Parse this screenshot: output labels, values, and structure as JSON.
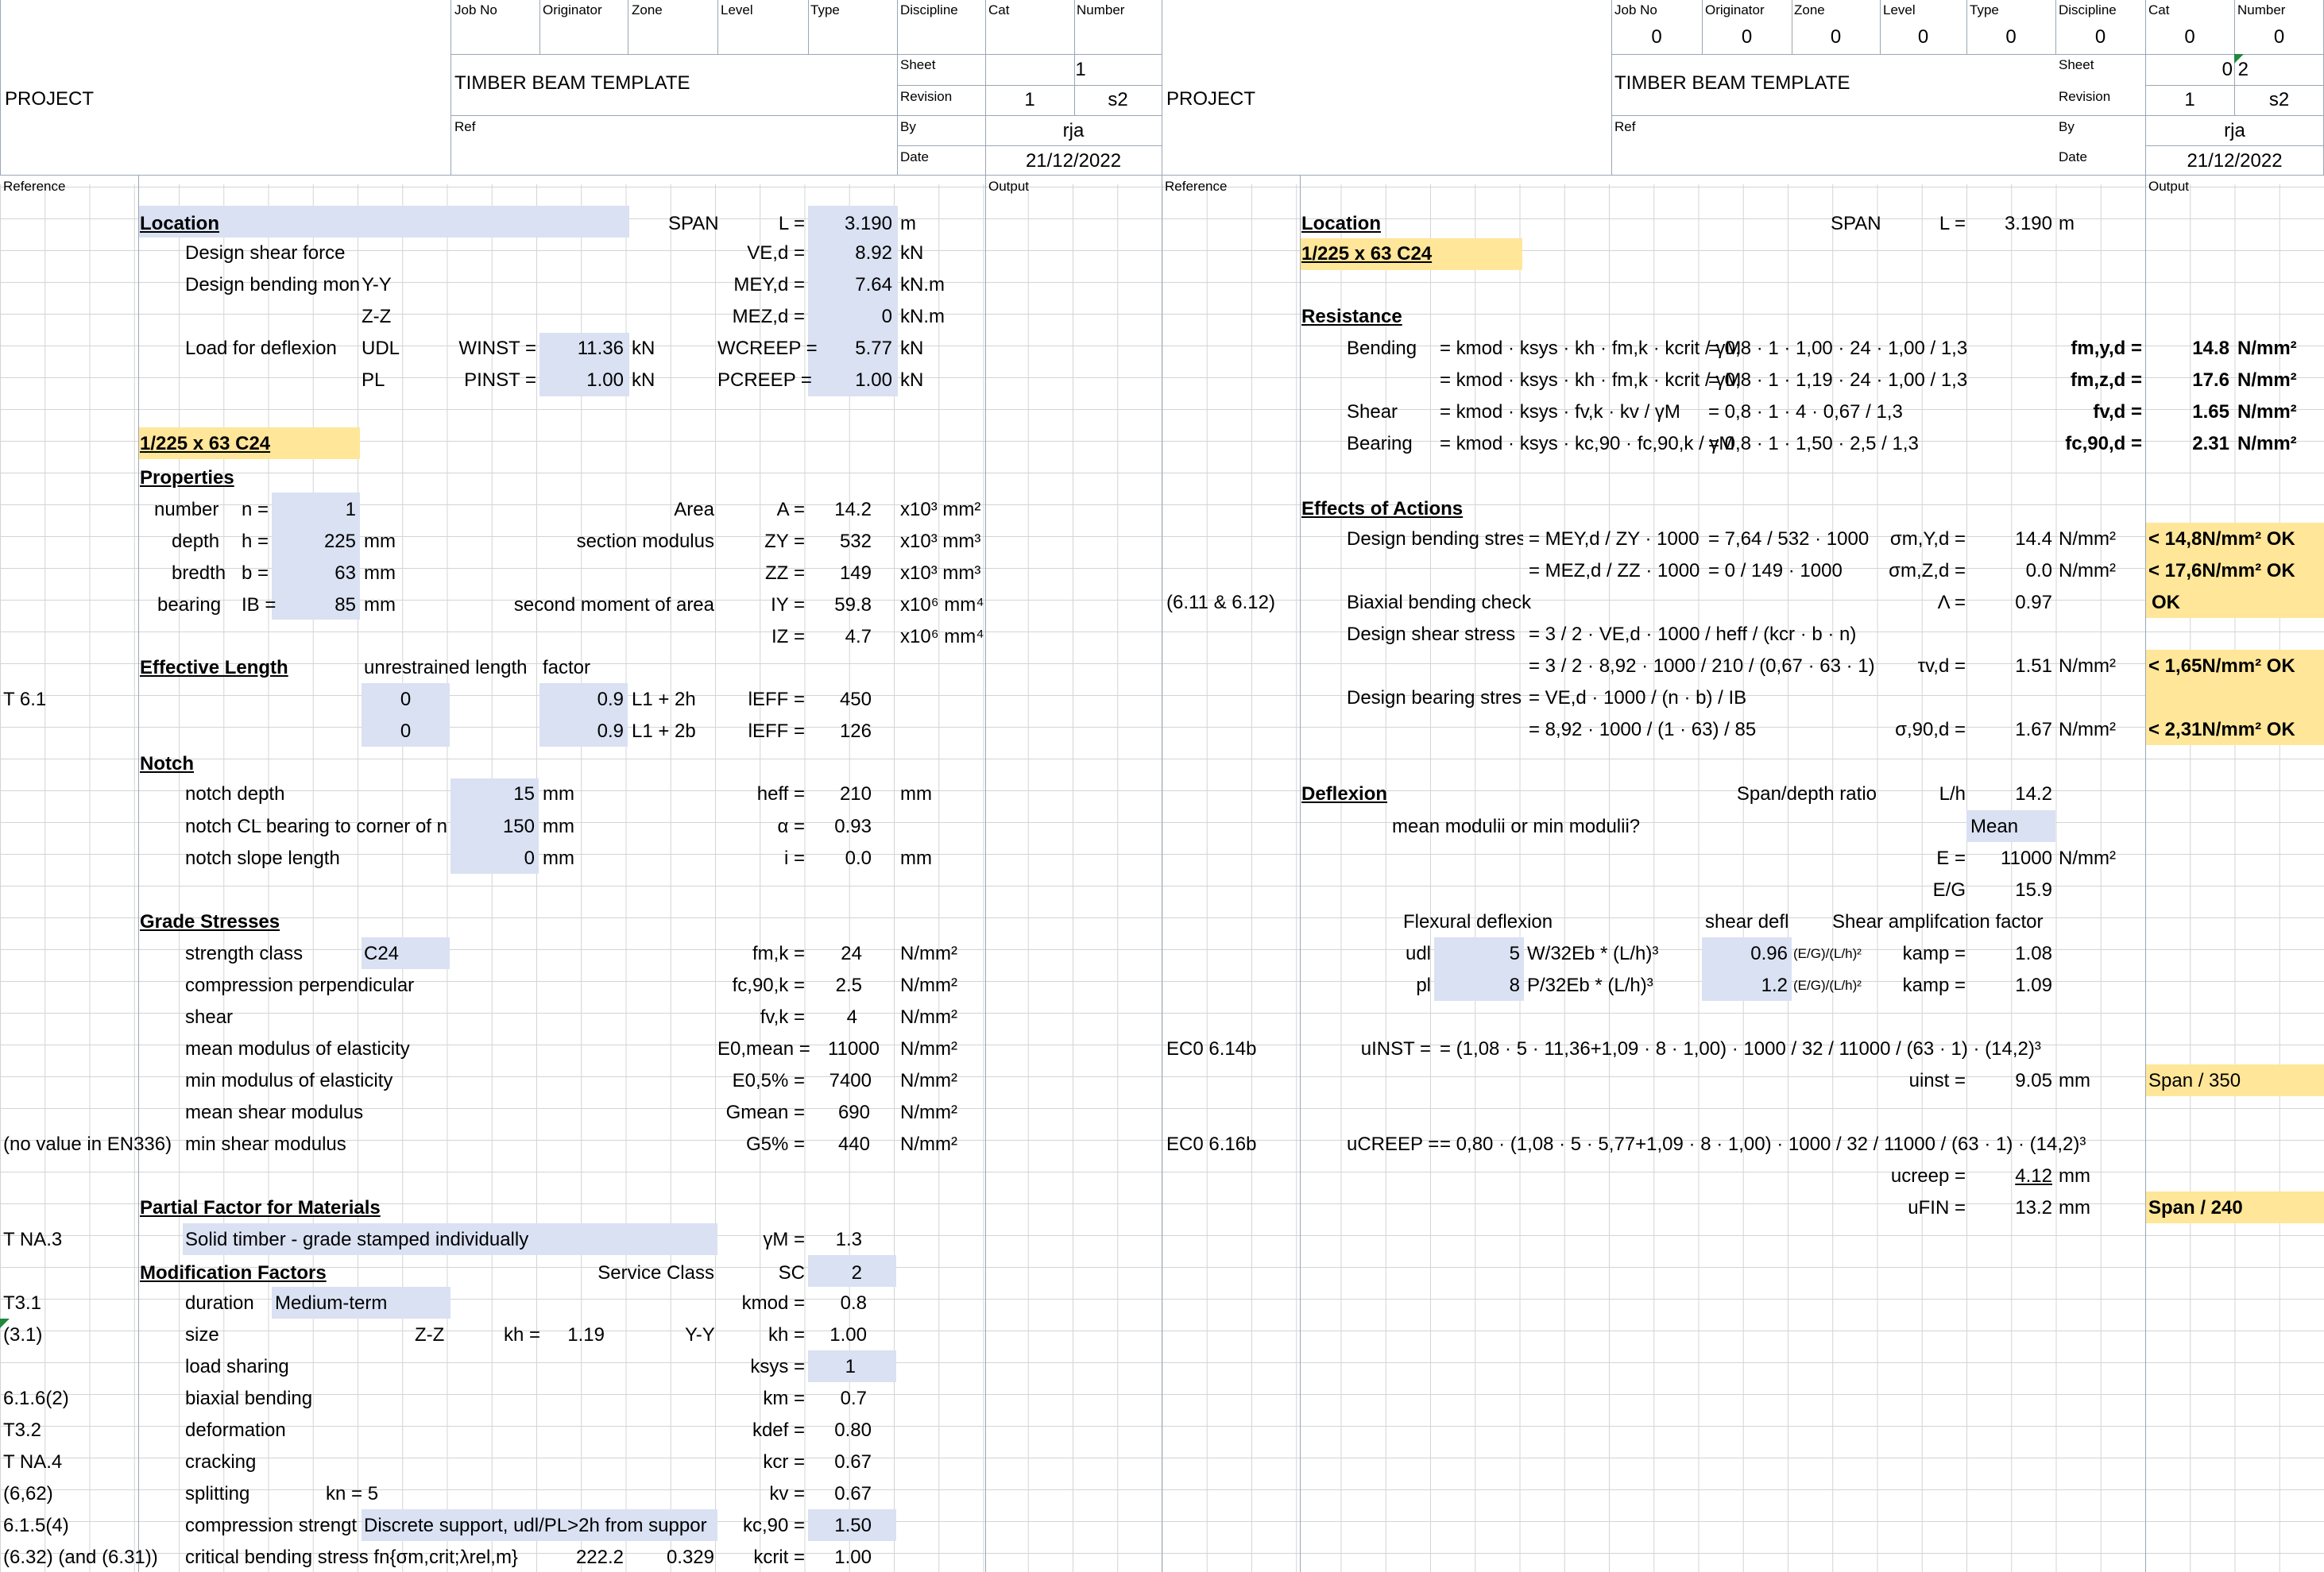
{
  "header_labels": [
    "Job No",
    "Originator",
    "Zone",
    "Level",
    "Type",
    "Discipline",
    "Cat",
    "Number",
    "Sheet",
    "Revision",
    "By",
    "Date",
    "Ref"
  ],
  "left_header": {
    "project": "PROJECT",
    "title": "TIMBER BEAM TEMPLATE",
    "sheet": "1",
    "revision": "1",
    "revision_code": "s2",
    "by": "rja",
    "date": "21/12/2022"
  },
  "right_header": {
    "project": "PROJECT",
    "title": "TIMBER BEAM TEMPLATE",
    "job_values": [
      "0",
      "0",
      "0",
      "0",
      "0",
      "0",
      "0",
      "0"
    ],
    "sheet": "0 2",
    "revision": "1",
    "revision_code": "s2",
    "by": "rja",
    "date": "21/12/2022"
  },
  "col_headers": {
    "reference": "Reference",
    "output": "Output"
  },
  "left": {
    "location": "Location",
    "span_label": "SPAN",
    "L_lbl": "L =",
    "L_val": "3.190",
    "L_unit": "m",
    "shear_force": "Design shear force",
    "VEd_lbl": "VE,d =",
    "VEd_val": "8.92",
    "VEd_unit": "kN",
    "bending_moment": "Design bending mon",
    "yy": "Y-Y",
    "MEy_lbl": "MEY,d =",
    "MEy_val": "7.64",
    "MEy_unit": "kN.m",
    "zz": "Z-Z",
    "MEz_lbl": "MEZ,d =",
    "MEz_val": "0",
    "MEz_unit": "kN.m",
    "load_defl": "Load for deflexion",
    "udl": "UDL",
    "winst_lbl": "WINST =",
    "winst_val": "11.36",
    "winst_unit": "kN",
    "wcreep_lbl": "WCREEP =",
    "wcreep_val": "5.77",
    "wcreep_unit": "kN",
    "pl": "PL",
    "pinst_lbl": "PINST =",
    "pinst_val": "1.00",
    "pinst_unit": "kN",
    "pcreep_lbl": "PCREEP =",
    "pcreep_val": "1.00",
    "pcreep_unit": "kN",
    "section": "1/225 x 63 C24",
    "properties": "Properties",
    "number": "number",
    "n_lbl": "n =",
    "n_val": "1",
    "area": "Area",
    "A_lbl": "A =",
    "A_val": "14.2",
    "A_unit": "x10³ mm²",
    "depth": "depth",
    "h_lbl": "h =",
    "h_val": "225",
    "h_unit": "mm",
    "sect_mod": "section modulus",
    "Zy_lbl": "ZY =",
    "Zy_val": "532",
    "Zy_unit": "x10³ mm³",
    "bredth": "bredth",
    "b_lbl": "b =",
    "b_val": "63",
    "b_unit": "mm",
    "Zz_lbl": "ZZ =",
    "Zz_val": "149",
    "Zz_unit": "x10³ mm³",
    "bearing": "bearing",
    "IB_lbl": "IB =",
    "IB_val": "85",
    "IB_unit": "mm",
    "second_moment": "second moment of area",
    "Iy_lbl": "IY =",
    "Iy_val": "59.8",
    "Iy_unit": "x10⁶ mm⁴",
    "Iz_lbl": "IZ =",
    "Iz_val": "4.7",
    "Iz_unit": "x10⁶ mm⁴",
    "eff_len": "Effective Length",
    "unrestrained": "unrestrained length",
    "factor": "factor",
    "t61": "T 6.1",
    "ul1": "0",
    "f1": "0.9",
    "lf1": "L1 + 2h",
    "ieff1_lbl": "lEFF =",
    "ieff1_val": "450",
    "ul2": "0",
    "f2": "0.9",
    "lf2": "L1 + 2b",
    "ieff2_lbl": "lEFF =",
    "ieff2_val": "126",
    "notch": "Notch",
    "notch_depth": "notch depth",
    "nd_val": "15",
    "nd_unit": "mm",
    "heff_lbl": "heff =",
    "heff_val": "210",
    "heff_unit": "mm",
    "notch_cl": "notch CL bearing to corner of n",
    "ncl_val": "150",
    "ncl_unit": "mm",
    "alpha_lbl": "α =",
    "alpha_val": "0.93",
    "notch_slope": "notch slope length",
    "ns_val": "0",
    "ns_unit": "mm",
    "i_lbl": "i =",
    "i_val": "0.0",
    "i_unit": "mm",
    "grade": "Grade Stresses",
    "strength_class": "strength class",
    "sc_val": "C24",
    "fmk_lbl": "fm,k =",
    "fmk_val": "24",
    "fmk_unit": "N/mm²",
    "comp_perp": "compression perpendicular",
    "fc90_lbl": "fc,90,k =",
    "fc90_val": "2.5",
    "fc90_unit": "N/mm²",
    "shear": "shear",
    "fvk_lbl": "fv,k =",
    "fvk_val": "4",
    "fvk_unit": "N/mm²",
    "mean_moe": "mean modulus of elasticity",
    "E0_lbl": "E0,mean =",
    "E0_val": "11000",
    "E0_unit": "N/mm²",
    "min_moe": "min modulus of elasticity",
    "E05_lbl": "E0,5% =",
    "E05_val": "7400",
    "E05_unit": "N/mm²",
    "mean_shear": "mean shear modulus",
    "Gm_lbl": "Gmean =",
    "Gm_val": "690",
    "Gm_unit": "N/mm²",
    "no_value": "(no value in EN336)",
    "min_shear": "min shear modulus",
    "G5_lbl": "G5% =",
    "G5_val": "440",
    "G5_unit": "N/mm²",
    "partial": "Partial Factor for Materials",
    "tna3": "T NA.3",
    "solid": "Solid timber - grade stamped individually",
    "gm_lbl": "γM =",
    "gm_val": "1.3",
    "modf": "Modification Factors",
    "service_class": "Service Class",
    "SC_lbl": "SC",
    "SC_val": "2",
    "t31": "T3.1",
    "duration": "duration",
    "dur_val": "Medium-term",
    "kmod_lbl": "kmod =",
    "kmod_val": "0.8",
    "r31": "(3.1)",
    "size": "size",
    "zz2": "Z-Z",
    "kh_lbl": "kh =",
    "kh_z": "1.19",
    "yy2": "Y-Y",
    "kh2_lbl": "kh =",
    "kh_y": "1.00",
    "load_sharing": "load sharing",
    "ksys_lbl": "ksys =",
    "ksys_val": "1",
    "r616": "6.1.6(2)",
    "biaxial": "biaxial bending",
    "km_lbl": "km =",
    "km_val": "0.7",
    "t32": "T3.2",
    "deformation": "deformation",
    "kdef_lbl": "kdef =",
    "kdef_val": "0.80",
    "tna4": "T NA.4",
    "cracking": "cracking",
    "kcr_lbl": "kcr =",
    "kcr_val": "0.67",
    "r662": "(6,62)",
    "splitting": "splitting",
    "kn_lbl": "kn = 5",
    "kv_lbl": "kv =",
    "kv_val": "0.67",
    "r615": "6.1.5(4)",
    "comp_strength": "compression strengt",
    "discrete": "Discrete support, udl/PL>2h from suppor",
    "kc90_lbl": "kc,90 =",
    "kc90_val": "1.50",
    "r632": "(6.32) (and (6.31))",
    "crit_bend": "critical bending stress fn{σm,crit;λrel,m}",
    "cb1": "222.2",
    "cb2": "0.329",
    "kcrit_lbl": "kcrit =",
    "kcrit_val": "1.00"
  },
  "right": {
    "location": "Location",
    "span_label": "SPAN",
    "L_lbl": "L =",
    "L_val": "3.190",
    "L_unit": "m",
    "section": "1/225 x 63 C24",
    "resistance": "Resistance",
    "bending": "Bending",
    "bend1_f": "= kmod · ksys · kh · fm,k · kcrit / γM",
    "bend1_n": "= 0,8 · 1 · 1,00 · 24 · 1,00 / 1,3",
    "bend1_lbl": "fm,y,d =",
    "bend1_val": "14.8",
    "bend1_unit": "N/mm²",
    "bend2_f": "= kmod · ksys · kh · fm,k · kcrit / γM",
    "bend2_n": "= 0,8 · 1 · 1,19 · 24 · 1,00 / 1,3",
    "bend2_lbl": "fm,z,d =",
    "bend2_val": "17.6",
    "bend2_unit": "N/mm²",
    "shear": "Shear",
    "shear_f": "= kmod · ksys · fv,k · kv / γM",
    "shear_n": "= 0,8 · 1 · 4 · 0,67 / 1,3",
    "shear_lbl": "fv,d =",
    "shear_val": "1.65",
    "shear_unit": "N/mm²",
    "bearing": "Bearing",
    "bear_f": "= kmod · ksys · kc,90 · fc,90,k / γM",
    "bear_n": "= 0,8 · 1 · 1,50 · 2,5 / 1,3",
    "bear_lbl": "fc,90,d =",
    "bear_val": "2.31",
    "bear_unit": "N/mm²",
    "effects": "Effects of Actions",
    "dbs": "Design bending stres",
    "dbs1_f": "= MEY,d / ZY · 1000",
    "dbs1_n": "= 7,64 / 532 · 1000",
    "dbs1_lbl": "σm,Y,d =",
    "dbs1_val": "14.4",
    "dbs1_unit": "N/mm²",
    "dbs1_out": "< 14,8N/mm²  OK",
    "dbs2_f": "= MEZ,d / ZZ · 1000",
    "dbs2_n": "= 0 / 149 · 1000",
    "dbs2_lbl": "σm,Z,d =",
    "dbs2_val": "0.0",
    "dbs2_unit": "N/mm²",
    "dbs2_out": "< 17,6N/mm²  OK",
    "eq611": "(6.11 & 6.12)",
    "biaxial": "Biaxial bending check",
    "lam_lbl": "Λ =",
    "lam_val": "0.97",
    "lam_out": "OK",
    "dss": "Design shear stress",
    "dss1_f": "= 3 / 2 · VE,d · 1000 / heff / (kcr · b · n)",
    "dss2_n": "= 3 / 2 · 8,92 · 1000 / 210 / (0,67 · 63 · 1)",
    "dss_lbl": "τv,d =",
    "dss_val": "1.51",
    "dss_unit": "N/mm²",
    "dss_out": "< 1,65N/mm²  OK",
    "dbrs": "Design bearing stres",
    "dbrs1_f": "= VE,d · 1000 / (n · b) / IB",
    "dbrs2_n": "= 8,92 · 1000 / (1 · 63) / 85",
    "dbrs_lbl": "σ,90,d =",
    "dbrs_val": "1.67",
    "dbrs_unit": "N/mm²",
    "dbrs_out": "< 2,31N/mm²  OK",
    "deflexion": "Deflexion",
    "spandepth": "Span/depth ratio",
    "Lh_lbl": "L/h",
    "Lh_val": "14.2",
    "meanmin": "mean modulii or min modulii?",
    "mean": "Mean",
    "E_lbl": "E =",
    "E_val": "11000",
    "E_unit": "N/mm²",
    "EG_lbl": "E/G",
    "EG_val": "15.9",
    "flex_defl": "Flexural deflexion",
    "shear_defl": "shear defl",
    "shear_amp": "Shear amplifcation factor",
    "udl": "udl",
    "udl_c": "5",
    "udl_f": "W/32Eb * (L/h)³",
    "udl_sd": "0.96",
    "udl_sdf": "(E/G)/(L/h)²",
    "kamp1_lbl": "kamp =",
    "kamp1_val": "1.08",
    "pl": "pl",
    "pl_c": "8",
    "pl_f": "P/32Eb * (L/h)³",
    "pl_sd": "1.2",
    "pl_sdf": "(E/G)/(L/h)²",
    "kamp2_lbl": "kamp =",
    "kamp2_val": "1.09",
    "eco1": "EC0 6.14b",
    "uinst_lbl": "uINST =",
    "uinst_f": "= (1,08 · 5 · 11,36+1,09 · 8 · 1,00) · 1000 / 32 / 11000 / (63 · 1) · (14,2)³",
    "uinst2_lbl": "uinst =",
    "uinst_val": "9.05",
    "uinst_unit": "mm",
    "uinst_out": "Span / 350",
    "eco2": "EC0 6.16b",
    "ucreep_lbl": "uCREEP =",
    "ucreep_f": "= 0,80 · (1,08 · 5 · 5,77+1,09 · 8 · 1,00) · 1000 / 32 / 11000 / (63 · 1) · (14,2)³",
    "ucreep2_lbl": "ucreep =",
    "ucreep_val": "4.12",
    "ucreep_unit": "mm",
    "ufin_lbl": "uFIN =",
    "ufin_val": "13.2",
    "ufin_unit": "mm",
    "ufin_out": "Span / 240"
  }
}
